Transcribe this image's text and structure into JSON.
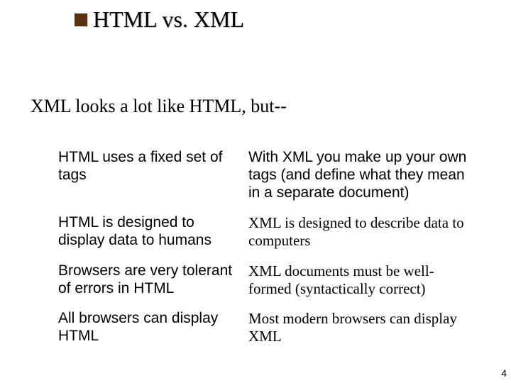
{
  "title": "HTML vs. XML",
  "subhead": "XML looks a lot like HTML, but--",
  "rows": [
    {
      "left": "HTML uses a fixed set of tags",
      "right": "With XML you make up your own tags (and define what they mean in a separate document)"
    },
    {
      "left": "HTML is designed to display data to humans",
      "right": "XML is designed to describe data to computers"
    },
    {
      "left": "Browsers are very tolerant of errors in HTML",
      "right": "XML documents must be well-formed (syntactically correct)"
    },
    {
      "left": "All browsers can display HTML",
      "right": "Most modern browsers can display XML"
    }
  ],
  "page_number": "4"
}
